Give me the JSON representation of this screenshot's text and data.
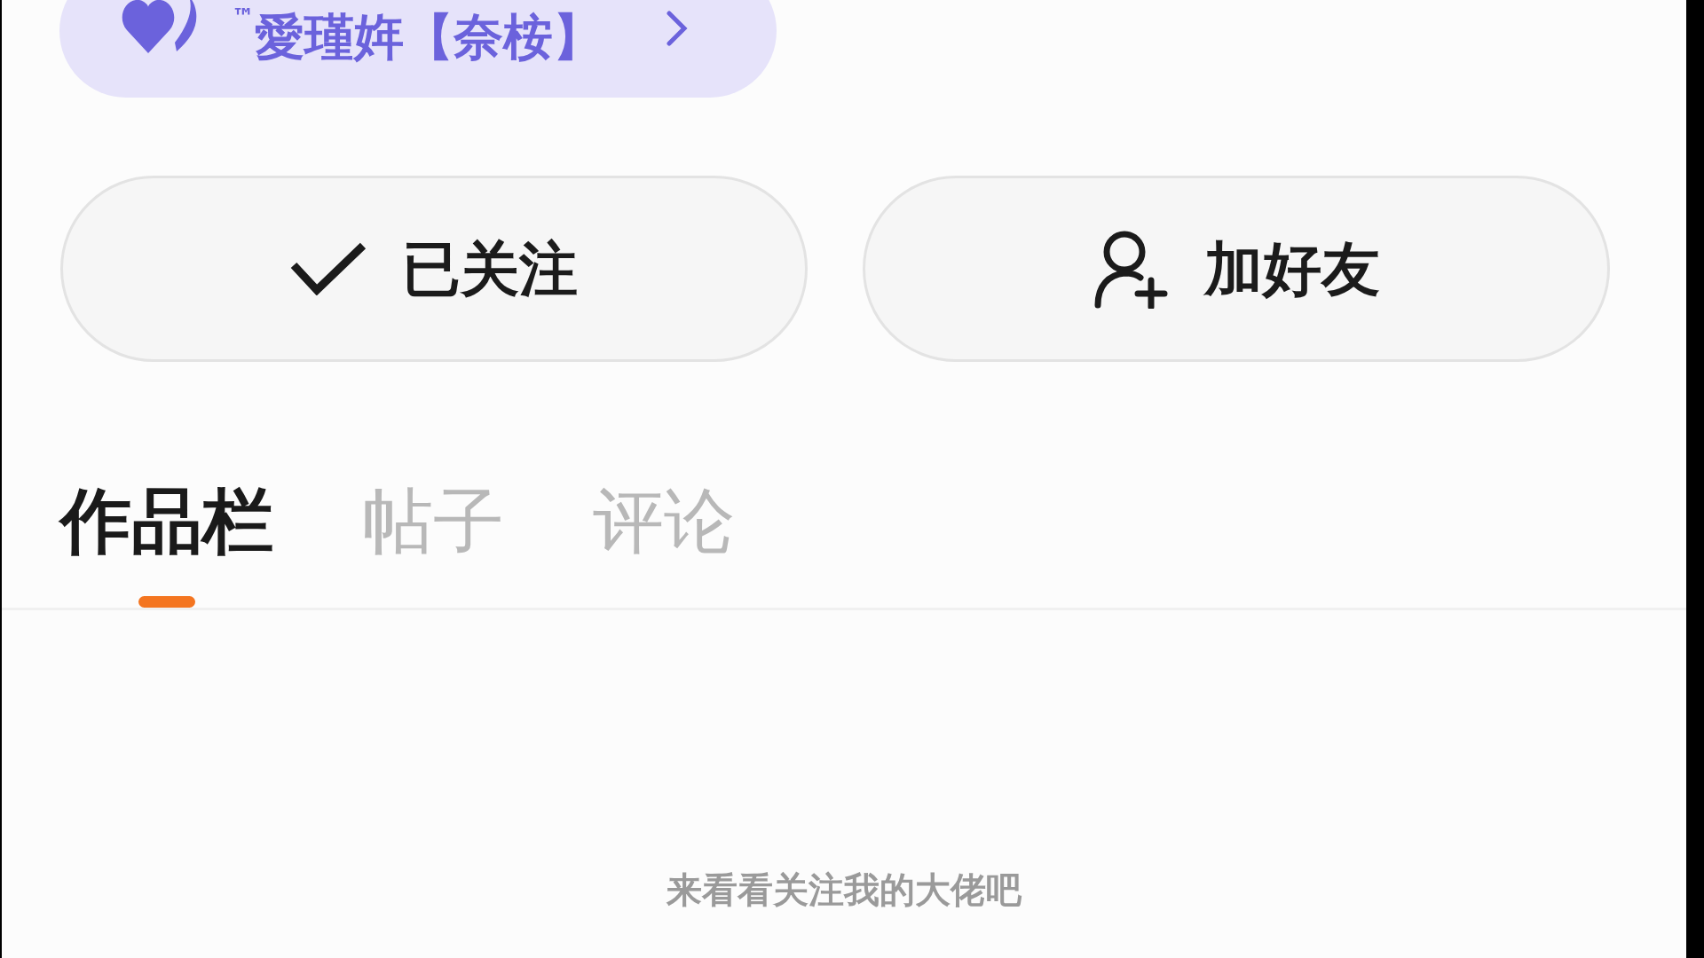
{
  "badge": {
    "text": "™愛瑾姩【奈桉】"
  },
  "actions": [
    {
      "kind": "followed",
      "label": "已关注"
    },
    {
      "kind": "add-friend",
      "label": "加好友"
    }
  ],
  "tabs": [
    {
      "label": "作品栏",
      "selected": true
    },
    {
      "label": "帖子",
      "selected": false
    },
    {
      "label": "评论",
      "selected": false
    }
  ],
  "subtitle": "来看看关注我的大佬吧"
}
